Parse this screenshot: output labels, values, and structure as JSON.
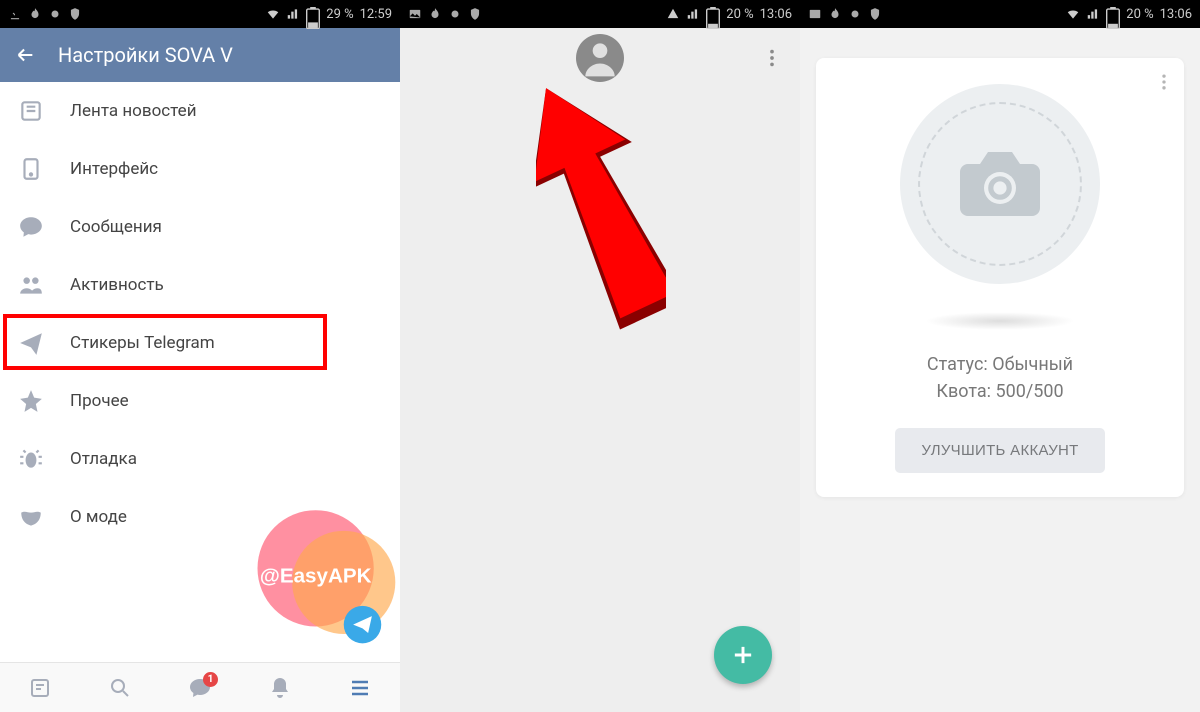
{
  "s1": {
    "status": {
      "battery": "29 %",
      "time": "12:59"
    },
    "title": "Настройки SOVA V",
    "items": [
      {
        "label": "Лента новостей"
      },
      {
        "label": "Интерфейс"
      },
      {
        "label": "Сообщения"
      },
      {
        "label": "Активность"
      },
      {
        "label": "Стикеры Telegram"
      },
      {
        "label": "Прочее"
      },
      {
        "label": "Отладка"
      },
      {
        "label": "О моде"
      }
    ],
    "highlighted_index": 4,
    "nav_badge": "1"
  },
  "s2": {
    "status": {
      "battery": "20 %",
      "time": "13:06"
    }
  },
  "s3": {
    "status": {
      "battery": "20 %",
      "time": "13:06"
    },
    "status_line": "Статус: Обычный",
    "quota_line": "Квота: 500/500",
    "upgrade_label": "УЛУЧШИТЬ АККАУНТ"
  },
  "watermark": "@EasyAPK"
}
